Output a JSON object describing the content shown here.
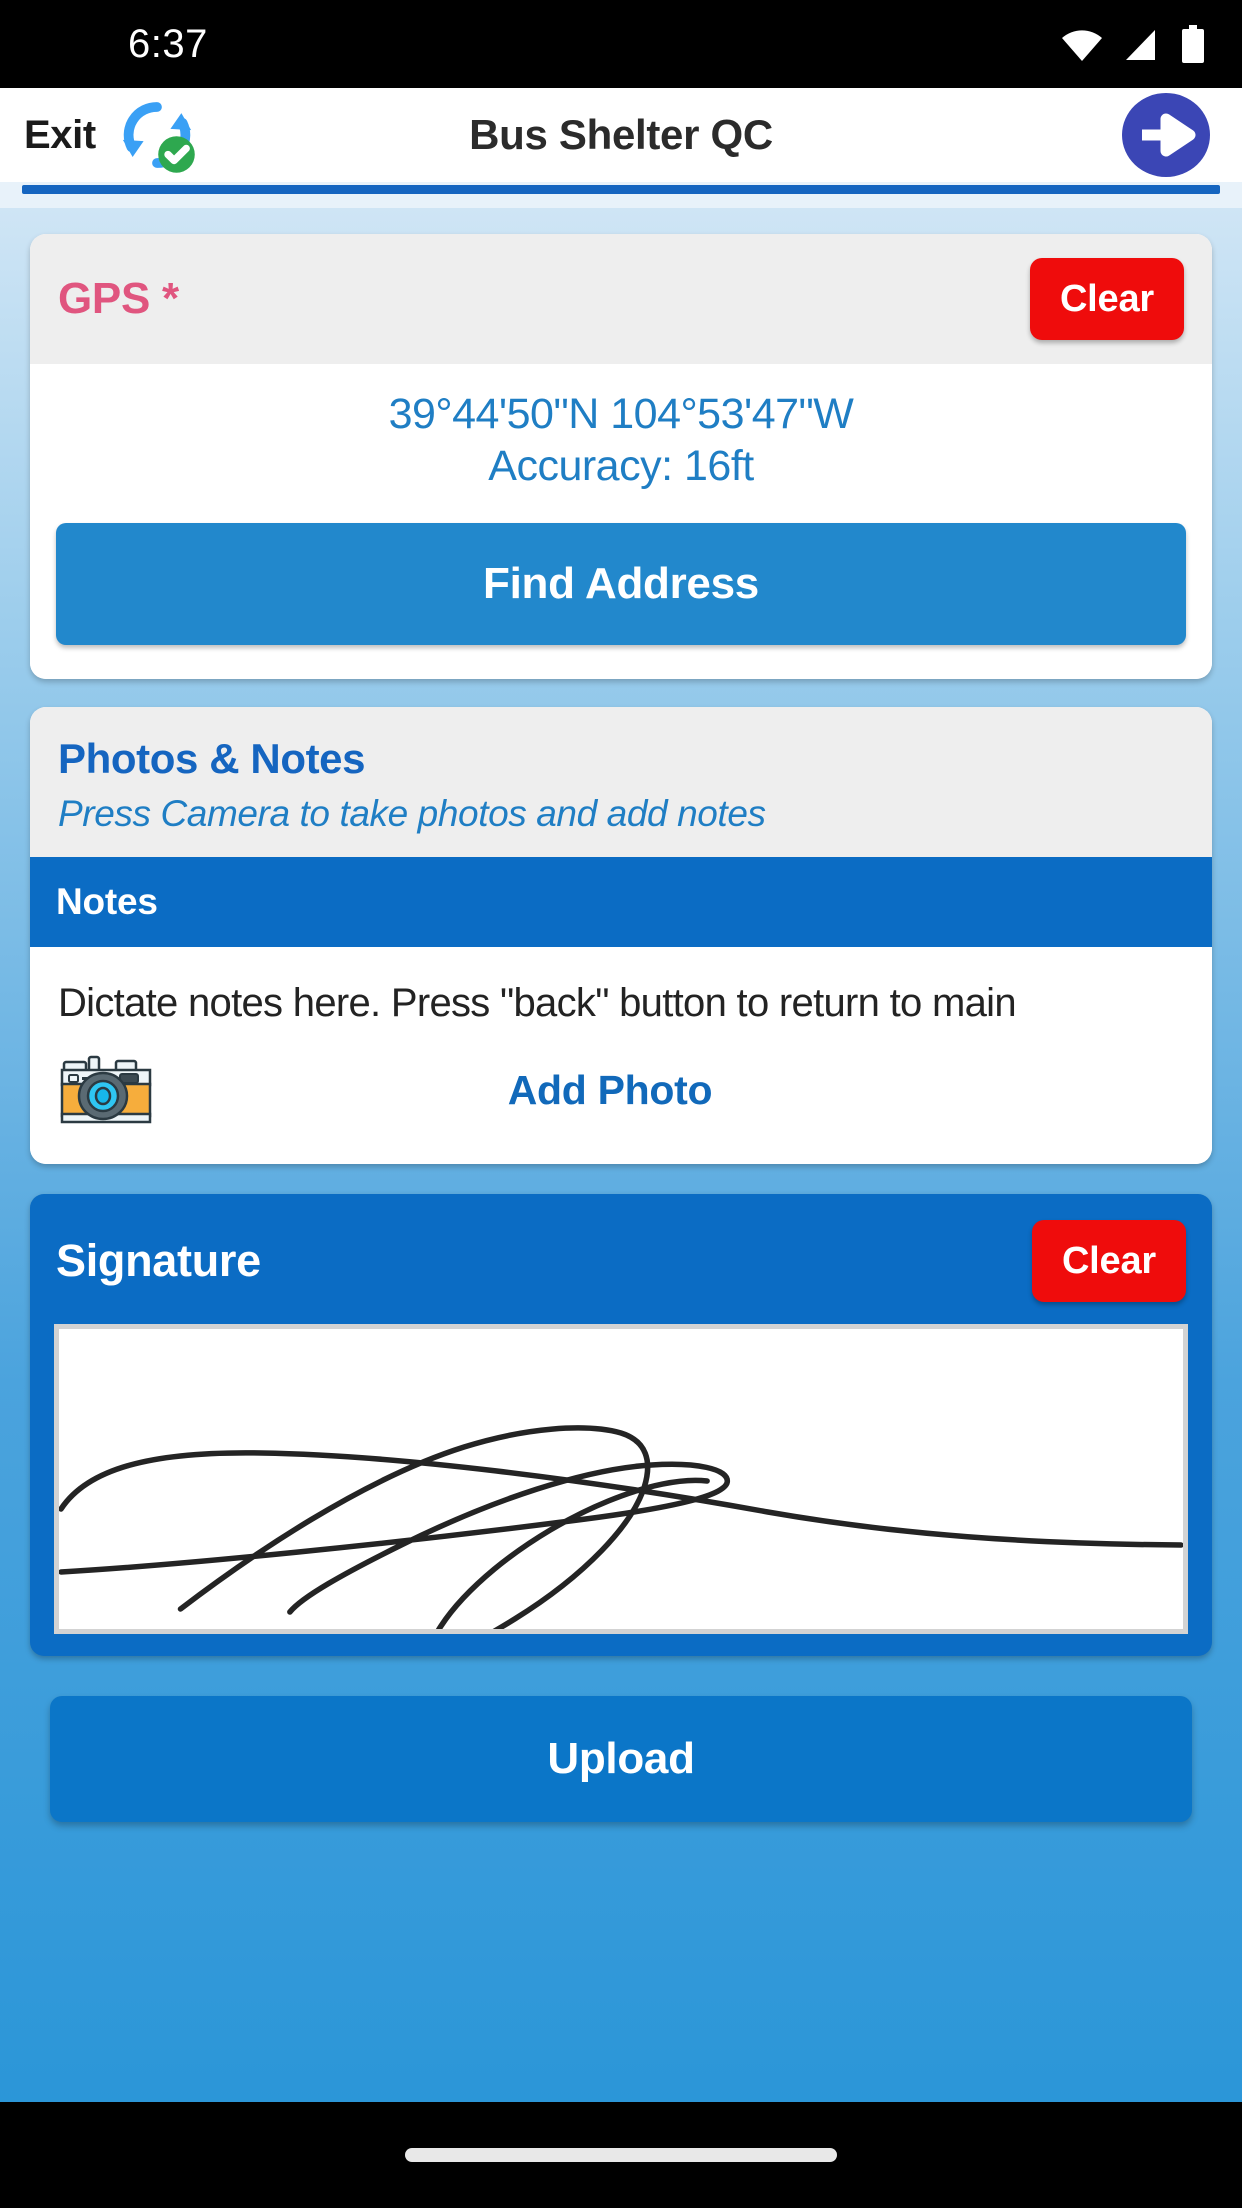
{
  "status_bar": {
    "time": "6:37",
    "icons": [
      "wifi-icon",
      "cellular-signal-icon",
      "battery-icon"
    ]
  },
  "toolbar": {
    "exit_label": "Exit",
    "sync_icon": "sync-complete-icon",
    "title": "Bus Shelter QC",
    "next_icon": "arrow-right-circle-icon"
  },
  "gps_card": {
    "title": "GPS *",
    "title_color": "#e0557f",
    "clear_label": "Clear",
    "clear_color": "#ef0c0c",
    "coordinates": "39°44'50\"N 104°53'47\"W",
    "accuracy": "Accuracy: 16ft",
    "find_address_label": "Find Address",
    "find_address_color": "#2288cc"
  },
  "photos_notes_card": {
    "title": "Photos & Notes",
    "subtitle": "Press Camera to take photos and add notes",
    "notes_header": "Notes",
    "notes_text": "Dictate notes here. Press \"back\" button to return to main",
    "camera_icon": "camera-icon",
    "add_photo_label": "Add Photo",
    "accent_color": "#0b6cc4"
  },
  "signature_card": {
    "title": "Signature",
    "clear_label": "Clear",
    "background_color": "#0b6cc4",
    "signature_present": true
  },
  "upload": {
    "label": "Upload",
    "color": "#0b76c8"
  },
  "nav_bar": {
    "home_indicator": "home-indicator"
  }
}
